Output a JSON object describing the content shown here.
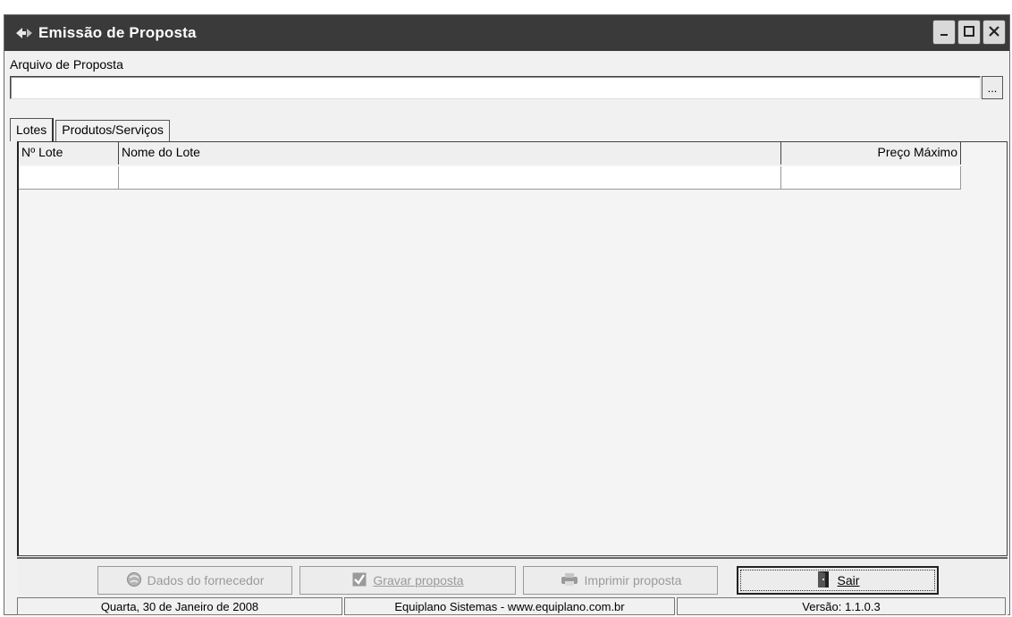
{
  "window": {
    "title": "Emissão de Proposta",
    "controls": {
      "minimize": "minimize",
      "maximize": "maximize",
      "close": "close"
    }
  },
  "file_section": {
    "label": "Arquivo de Proposta",
    "value": "",
    "browse_label": "..."
  },
  "tabs": [
    {
      "label": "Lotes",
      "active": true
    },
    {
      "label": "Produtos/Serviços",
      "active": false
    }
  ],
  "grid": {
    "columns": [
      "Nº Lote",
      "Nome do Lote",
      "Preço Máximo"
    ],
    "rows": [
      [
        "",
        "",
        ""
      ]
    ]
  },
  "buttons": {
    "dados_fornecedor": "Dados do fornecedor",
    "gravar_proposta": "Gravar proposta",
    "imprimir_proposta": "Imprimir proposta",
    "sair": "Sair"
  },
  "status": {
    "date": "Quarta, 30 de Janeiro de 2008",
    "company": "Equiplano Sistemas - www.equiplano.com.br",
    "version": "Versão: 1.1.0.3"
  },
  "icons": {
    "app": "app-icon",
    "dados": "globe-icon",
    "gravar": "checkbox-save-icon",
    "imprimir": "printer-icon",
    "sair": "door-exit-icon"
  },
  "colors": {
    "titlebar": "#3a3a3a",
    "window_bg": "#f1f1f1",
    "disabled_text": "#9a9a9a"
  }
}
